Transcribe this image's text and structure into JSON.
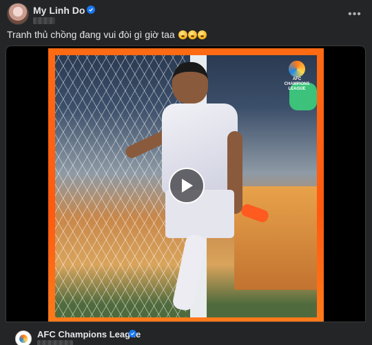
{
  "post": {
    "author": "My Linh Do",
    "caption": "Tranh thủ chồng đang vui đòi gì giờ taa",
    "caption_emoji": [
      "surprised-face",
      "surprised-face",
      "surprised-face"
    ],
    "more_icon": "•••"
  },
  "media": {
    "logo_lines": [
      "AFC",
      "CHAMPIONS",
      "LEAGUE"
    ],
    "play_icon": "play-icon"
  },
  "source": {
    "name": "AFC Champions League"
  },
  "colors": {
    "background": "#242526",
    "frame": "#ff6a13",
    "verified": "#1877f2"
  }
}
